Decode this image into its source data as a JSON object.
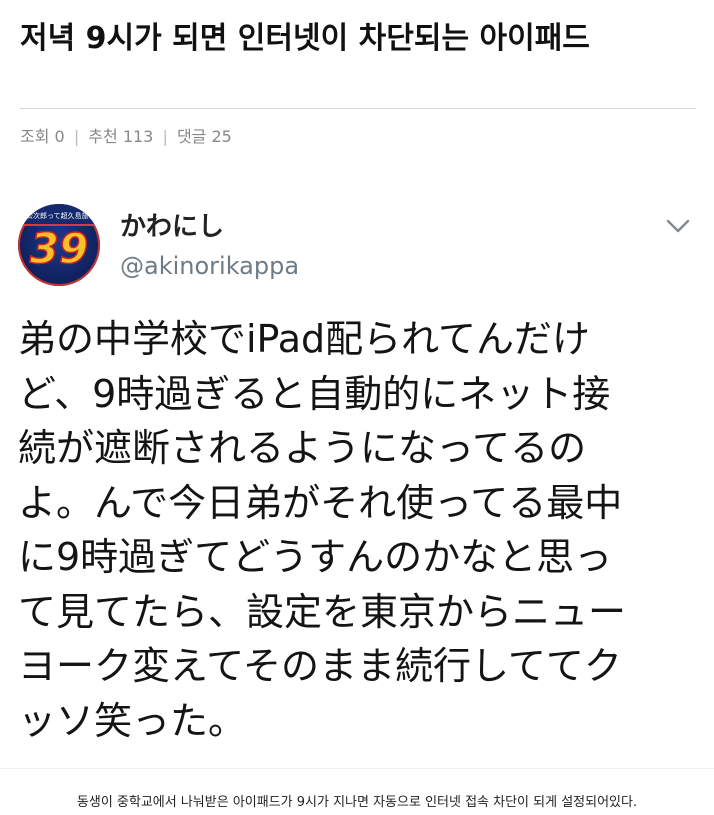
{
  "post": {
    "title": "저녁 9시가 되면 인터넷이 차단되는 아이패드",
    "views_label": "조회 0",
    "recommend_label": "추천 113",
    "comments_label": "댓글 25",
    "separator": "|"
  },
  "tweet": {
    "avatar_number": "39",
    "avatar_small_text": "公次郎って超久島旅行",
    "display_name": "かわにし",
    "handle": "@akinorikappa",
    "menu_icon": "chevron-down-icon",
    "text": "弟の中学校でiPad配られてんだけ\nど、9時過ぎると自動的にネット接\n続が遮断されるようになってるの\nよ。んで今日弟がそれ使ってる最中\nに9時過ぎてどうすんのかなと思っ\nて見てたら、設定を東京からニュー\nヨーク変えてそのまま続行しててク\nッソ笑った。"
  },
  "caption": "동생이 중학교에서 나눠받은 아이패드가 9시가 지나면 자동으로 인터넷 접속 차단이 되게 설정되어있다.",
  "colors": {
    "text": "#141414",
    "meta": "#888888",
    "handle": "#6e7b85",
    "avatar_number": "#f6c12b"
  }
}
